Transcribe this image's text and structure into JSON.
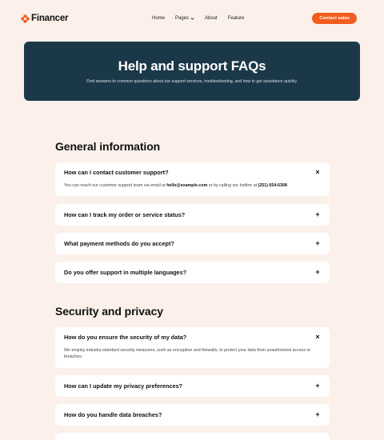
{
  "brand": {
    "name": "Financer",
    "accent": "#f25c1f",
    "hero_bg": "#1b3848",
    "page_bg": "#fbf0ea"
  },
  "nav": {
    "items": [
      {
        "label": "Home"
      },
      {
        "label": "Pages",
        "has_dropdown": true
      },
      {
        "label": "About"
      },
      {
        "label": "Feature"
      }
    ],
    "cta_label": "Contact sales"
  },
  "hero": {
    "title": "Help and support FAQs",
    "subtitle": "Find answers to common questions about our support services, troubleshooting, and how to get assistance quickly."
  },
  "sections": [
    {
      "title": "General information",
      "faqs": [
        {
          "question": "How can I contact customer support?",
          "expanded": true,
          "answer_prefix": "You can reach our customer support team via email at ",
          "email": "hello@example.com",
          "answer_middle": " or by calling our hotline at ",
          "phone": "(251) 654-6308",
          "answer_suffix": "."
        },
        {
          "question": "How can I track my order or service status?",
          "expanded": false
        },
        {
          "question": "What payment methods do you accept?",
          "expanded": false
        },
        {
          "question": "Do you offer support in multiple languages?",
          "expanded": false
        }
      ]
    },
    {
      "title": "Security and privacy",
      "faqs": [
        {
          "question": "How do you ensure the security of my data?",
          "expanded": true,
          "answer": "We employ industry-standard security measures, such as encryption and firewalls, to protect your data from unauthorized access or breaches."
        },
        {
          "question": "How can I update my privacy preferences?",
          "expanded": false
        },
        {
          "question": "How do you handle data breaches?",
          "expanded": false
        }
      ]
    }
  ],
  "icons": {
    "expanded": "×",
    "collapsed": "+",
    "dropdown": "chevron-down-icon",
    "logo": "flower-logo-icon"
  }
}
